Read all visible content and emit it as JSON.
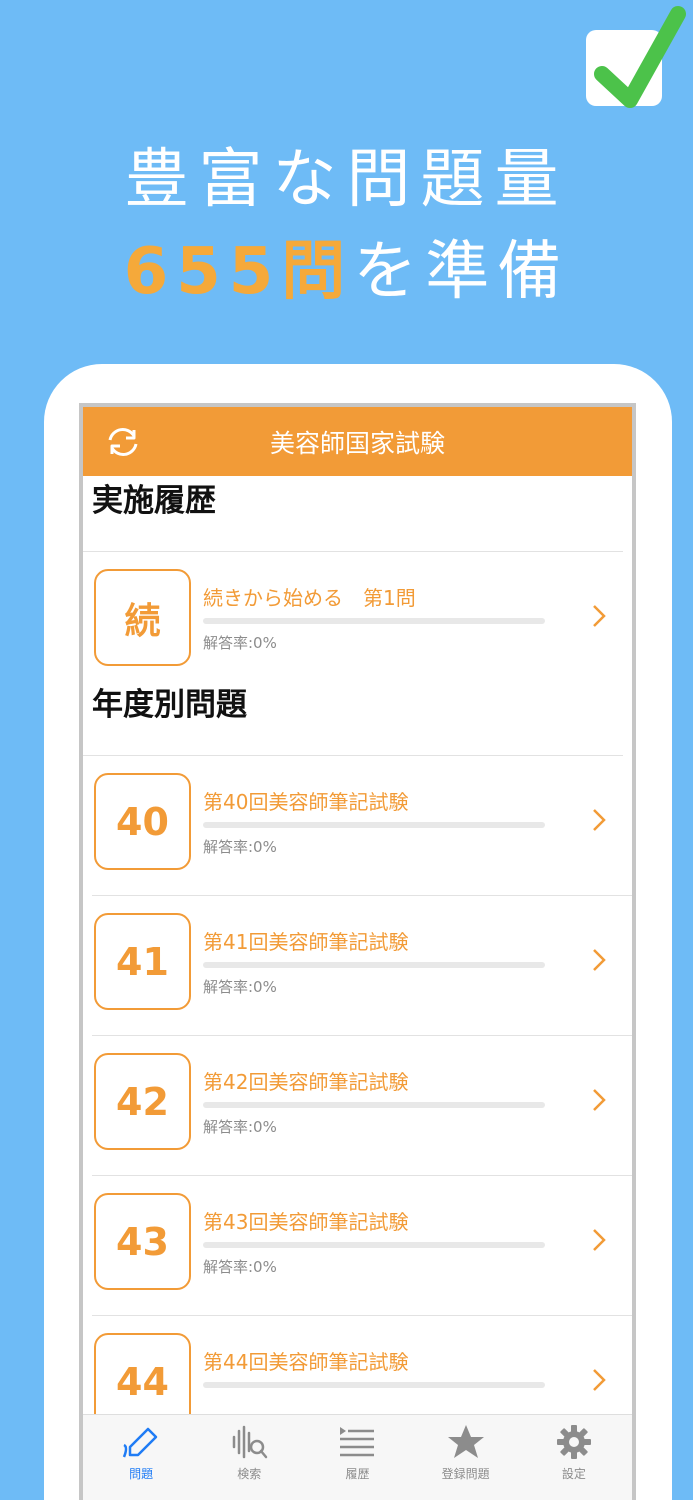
{
  "promo": {
    "line1": "豊富な問題量",
    "line2_highlight": "655問",
    "line2_rest": "を準備",
    "accent_color": "#f5a93a",
    "background_color": "#6ebbf6"
  },
  "app": {
    "title": "美容師国家試験",
    "refresh_icon": "refresh-icon",
    "brand_color": "#f29b37"
  },
  "history_section": {
    "title": "実施履歴",
    "item": {
      "badge": "続",
      "label": "続きから始める　第1問",
      "rate": "解答率:0%",
      "progress": 0
    }
  },
  "year_section": {
    "title": "年度別問題",
    "items": [
      {
        "badge": "40",
        "label": "第40回美容師筆記試験",
        "rate": "解答率:0%",
        "progress": 0
      },
      {
        "badge": "41",
        "label": "第41回美容師筆記試験",
        "rate": "解答率:0%",
        "progress": 0
      },
      {
        "badge": "42",
        "label": "第42回美容師筆記試験",
        "rate": "解答率:0%",
        "progress": 0
      },
      {
        "badge": "43",
        "label": "第43回美容師筆記試験",
        "rate": "解答率:0%",
        "progress": 0
      },
      {
        "badge": "44",
        "label": "第44回美容師筆記試験",
        "rate": "",
        "progress": 0
      }
    ]
  },
  "tabbar": {
    "tabs": [
      {
        "label": "問題",
        "icon": "pencil-icon",
        "active": true
      },
      {
        "label": "検索",
        "icon": "waveform-search-icon",
        "active": false
      },
      {
        "label": "履歴",
        "icon": "list-icon",
        "active": false
      },
      {
        "label": "登録問題",
        "icon": "star-icon",
        "active": false
      },
      {
        "label": "設定",
        "icon": "gear-icon",
        "active": false
      }
    ],
    "active_color": "#1f7cf5"
  }
}
